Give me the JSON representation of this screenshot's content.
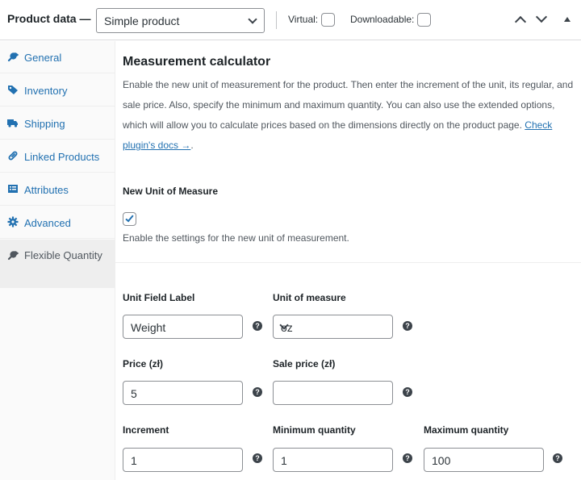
{
  "header": {
    "title": "Product data —",
    "product_type": "Simple product",
    "virtual_label": "Virtual:",
    "downloadable_label": "Downloadable:"
  },
  "sidebar": {
    "items": [
      {
        "label": "General",
        "icon": "wrench-icon"
      },
      {
        "label": "Inventory",
        "icon": "tag-icon"
      },
      {
        "label": "Shipping",
        "icon": "truck-icon"
      },
      {
        "label": "Linked Products",
        "icon": "link-icon"
      },
      {
        "label": "Attributes",
        "icon": "list-icon"
      },
      {
        "label": "Advanced",
        "icon": "gear-icon"
      },
      {
        "label": "Flexible Quantity",
        "icon": "wrench-icon",
        "active": true
      }
    ]
  },
  "main": {
    "heading": "Measurement calculator",
    "description": "Enable the new unit of measurement for the product. Then enter the increment of the unit, its regular, and sale price. Also, specify the minimum and maximum quantity. You can also use the extended options, which will allow you to calculate prices based on the dimensions directly on the product page.",
    "docs_link": "Check plugin's docs →",
    "after_link": ".",
    "new_unit_label": "New Unit of Measure",
    "new_unit_checked": true,
    "new_unit_help": "Enable the settings for the new unit of measurement.",
    "unit_field_label": "Unit Field Label",
    "unit_field_value": "Weight",
    "unit_of_measure_label": "Unit of measure",
    "unit_of_measure_value": "oz",
    "price_label": "Price (zł)",
    "price_value": "5",
    "sale_price_label": "Sale price (zł)",
    "sale_price_value": "",
    "increment_label": "Increment",
    "increment_value": "1",
    "min_qty_label": "Minimum quantity",
    "min_qty_value": "1",
    "max_qty_label": "Maximum quantity",
    "max_qty_value": "100",
    "help_glyph": "?"
  },
  "colors": {
    "link": "#2271b1",
    "text": "#1d2327",
    "muted": "#50575e"
  }
}
